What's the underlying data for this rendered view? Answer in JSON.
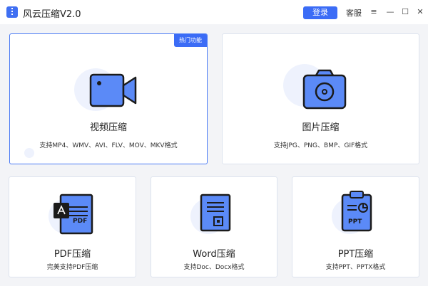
{
  "app": {
    "title": "风云压缩V2.0",
    "login_label": "登录",
    "service_label": "客服",
    "menu_glyph": "≡",
    "minimize_glyph": "—",
    "maximize_glyph": "☐",
    "close_glyph": "✕"
  },
  "cards": {
    "video": {
      "title": "视频压缩",
      "desc": "支持MP4、WMV、AVI、FLV、MOV、MKV格式",
      "badge": "热门功能"
    },
    "image": {
      "title": "图片压缩",
      "desc": "支持JPG、PNG、BMP、GIF格式"
    },
    "pdf": {
      "title": "PDF压缩",
      "desc": "完美支持PDF压缩",
      "icon_text": "PDF"
    },
    "word": {
      "title": "Word压缩",
      "desc": "支持Doc、Docx格式"
    },
    "ppt": {
      "title": "PPT压缩",
      "desc": "支持PPT、PPTX格式",
      "icon_text": "PPT"
    }
  },
  "colors": {
    "accent": "#3b6cf6",
    "icon_fill": "#5b8af7",
    "background": "#f3f4f7"
  }
}
